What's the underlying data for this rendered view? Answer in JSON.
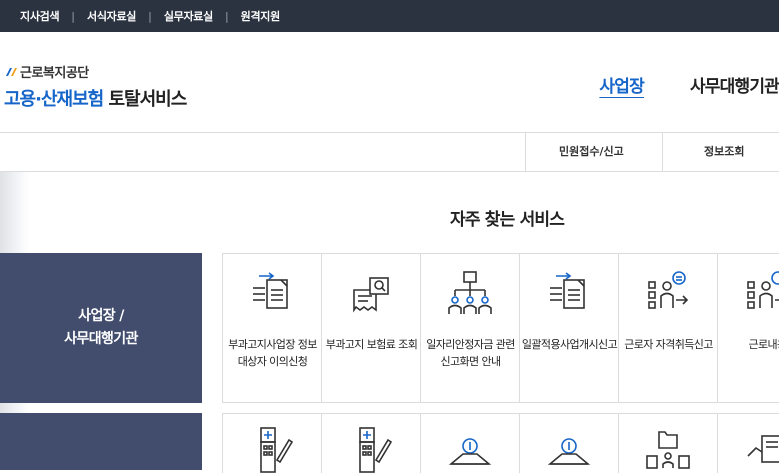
{
  "topbar": {
    "items": [
      "지사검색",
      "서식자료실",
      "실무자료실",
      "원격지원"
    ],
    "separator": "|"
  },
  "logo": {
    "org_name": "근로복지공단",
    "service_blue": "고용·산재보험",
    "service_dark": "토탈서비스"
  },
  "gnb": {
    "items": [
      {
        "label": "사업장",
        "active": true
      },
      {
        "label": "사무대행기관",
        "active": false
      }
    ]
  },
  "subnav": {
    "items": [
      "민원접수/신고",
      "정보조회"
    ]
  },
  "main": {
    "title": "자주 찾는 서비스",
    "categories": [
      {
        "lines": [
          "사업장 /",
          "사무대행기관"
        ]
      },
      {
        "lines": []
      }
    ],
    "row1": [
      {
        "label": "부과고지사업장 정보\n대상자 이의신청",
        "icon": "document-transfer-icon"
      },
      {
        "label": "부과고지 보험료 조회",
        "icon": "receipt-search-icon"
      },
      {
        "label": "일자리안정자금 관련\n신고화면 안내",
        "icon": "organization-chart-icon"
      },
      {
        "label": "일괄적용사업개시신고",
        "icon": "document-transfer-icon"
      },
      {
        "label": "근로자 자격취득신고",
        "icon": "person-list-arrow-icon"
      },
      {
        "label": "근로내용",
        "icon": "person-list-arrow-icon"
      }
    ],
    "row2": [
      {
        "icon": "hospital-form-icon"
      },
      {
        "icon": "hospital-form-icon"
      },
      {
        "icon": "coin-stack-icon"
      },
      {
        "icon": "coin-stack-icon"
      },
      {
        "icon": "folder-people-icon"
      },
      {
        "icon": "cards-hand-icon"
      }
    ]
  },
  "colors": {
    "topbar_bg": "#2b3240",
    "accent_blue": "#1666c9",
    "category_bg": "#424d6e",
    "icon_stroke": "#333333"
  }
}
